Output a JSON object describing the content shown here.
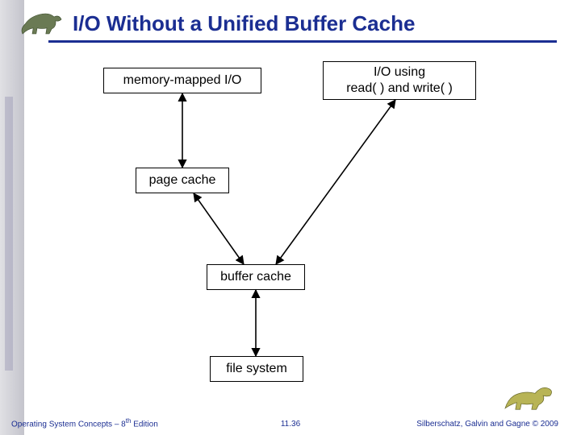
{
  "title": "I/O Without a Unified Buffer Cache",
  "diagram": {
    "nodes": {
      "mm": {
        "label": "memory-mapped I/O"
      },
      "rw": {
        "label": "I/O using\nread( ) and write( )"
      },
      "pc": {
        "label": "page cache"
      },
      "bc": {
        "label": "buffer cache"
      },
      "fs": {
        "label": "file system"
      }
    },
    "edges": [
      {
        "from": "mm",
        "to": "pc",
        "bidirectional": true
      },
      {
        "from": "pc",
        "to": "bc",
        "bidirectional": true
      },
      {
        "from": "rw",
        "to": "bc",
        "bidirectional": true
      },
      {
        "from": "bc",
        "to": "fs",
        "bidirectional": true
      }
    ]
  },
  "footer": {
    "left_prefix": "Operating System Concepts – 8",
    "left_ord": "th",
    "left_suffix": " Edition",
    "page": "11.36",
    "right": "Silberschatz, Galvin and Gagne © 2009"
  },
  "icons": {
    "top_left": "dinosaur-icon",
    "bottom_right": "dinosaur-icon"
  },
  "colors": {
    "title": "#1b2e92",
    "rule": "#1b2e92",
    "box_border": "#000000"
  }
}
